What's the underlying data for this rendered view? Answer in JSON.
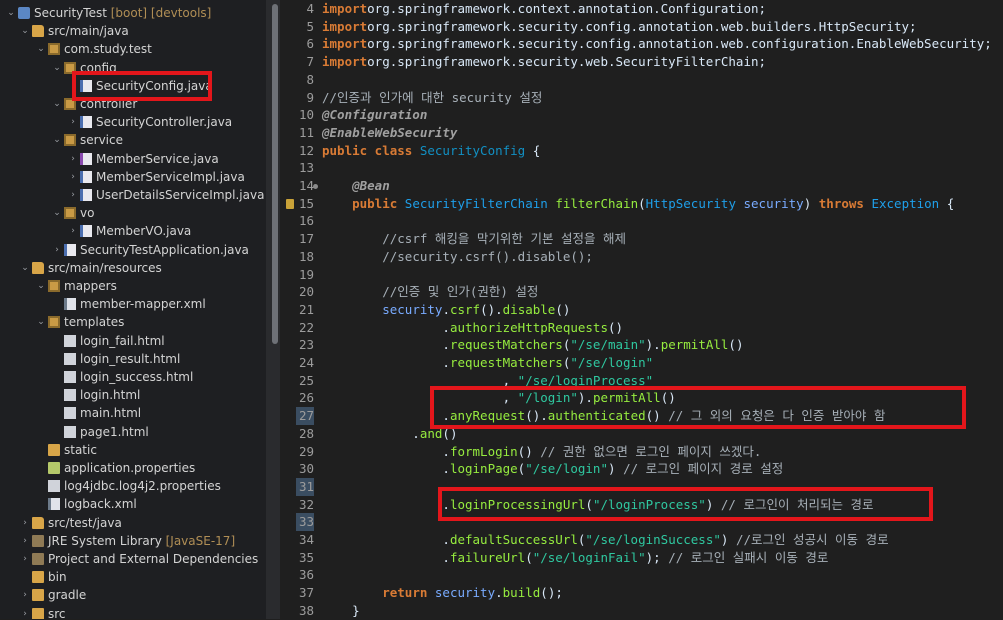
{
  "explorer": {
    "items": [
      {
        "label": "SecurityTest",
        "deco": " [boot] [devtools]",
        "arrow": "down",
        "icon": "project-icon"
      },
      {
        "label": "src/main/java",
        "deco": "",
        "arrow": "down",
        "icon": "source-folder-icon"
      },
      {
        "label": "com.study.test",
        "deco": "",
        "arrow": "down",
        "icon": "package-icon"
      },
      {
        "label": "config",
        "deco": "",
        "arrow": "down",
        "icon": "package-icon"
      },
      {
        "label": "SecurityConfig.java",
        "deco": "",
        "arrow": "right",
        "icon": "java-file-icon"
      },
      {
        "label": "controller",
        "deco": "",
        "arrow": "down",
        "icon": "package-icon"
      },
      {
        "label": "SecurityController.java",
        "deco": "",
        "arrow": "right",
        "icon": "java-file-icon"
      },
      {
        "label": "service",
        "deco": "",
        "arrow": "down",
        "icon": "package-icon"
      },
      {
        "label": "MemberService.java",
        "deco": "",
        "arrow": "right",
        "icon": "java-interface-icon"
      },
      {
        "label": "MemberServiceImpl.java",
        "deco": "",
        "arrow": "right",
        "icon": "java-file-icon"
      },
      {
        "label": "UserDetailsServiceImpl.java",
        "deco": "",
        "arrow": "right",
        "icon": "java-file-icon"
      },
      {
        "label": "vo",
        "deco": "",
        "arrow": "down",
        "icon": "package-icon"
      },
      {
        "label": "MemberVO.java",
        "deco": "",
        "arrow": "right",
        "icon": "java-file-icon"
      },
      {
        "label": "SecurityTestApplication.java",
        "deco": "",
        "arrow": "right",
        "icon": "java-file-icon"
      },
      {
        "label": "src/main/resources",
        "deco": "",
        "arrow": "down",
        "icon": "source-folder-icon"
      },
      {
        "label": "mappers",
        "deco": "",
        "arrow": "down",
        "icon": "package-icon"
      },
      {
        "label": "member-mapper.xml",
        "deco": "",
        "arrow": "",
        "icon": "xml-file-icon"
      },
      {
        "label": "templates",
        "deco": "",
        "arrow": "down",
        "icon": "package-icon"
      },
      {
        "label": "login_fail.html",
        "deco": "",
        "arrow": "",
        "icon": "html-file-icon"
      },
      {
        "label": "login_result.html",
        "deco": "",
        "arrow": "",
        "icon": "html-file-icon"
      },
      {
        "label": "login_success.html",
        "deco": "",
        "arrow": "",
        "icon": "html-file-icon"
      },
      {
        "label": "login.html",
        "deco": "",
        "arrow": "",
        "icon": "html-file-icon"
      },
      {
        "label": "main.html",
        "deco": "",
        "arrow": "",
        "icon": "html-file-icon"
      },
      {
        "label": "page1.html",
        "deco": "",
        "arrow": "",
        "icon": "html-file-icon"
      },
      {
        "label": "static",
        "deco": "",
        "arrow": "",
        "icon": "folder-icon"
      },
      {
        "label": "application.properties",
        "deco": "",
        "arrow": "",
        "icon": "properties-file-icon"
      },
      {
        "label": "log4jdbc.log4j2.properties",
        "deco": "",
        "arrow": "",
        "icon": "file-icon"
      },
      {
        "label": "logback.xml",
        "deco": "",
        "arrow": "",
        "icon": "xml-file-icon"
      },
      {
        "label": "src/test/java",
        "deco": "",
        "arrow": "right",
        "icon": "source-folder-icon"
      },
      {
        "label": "JRE System Library",
        "deco": " [JavaSE-17]",
        "arrow": "right",
        "icon": "library-icon"
      },
      {
        "label": "Project and External Dependencies",
        "deco": "",
        "arrow": "right",
        "icon": "library-icon"
      },
      {
        "label": "bin",
        "deco": "",
        "arrow": "",
        "icon": "folder-icon"
      },
      {
        "label": "gradle",
        "deco": "",
        "arrow": "right",
        "icon": "folder-icon"
      },
      {
        "label": "src",
        "deco": "",
        "arrow": "right",
        "icon": "folder-icon"
      }
    ]
  },
  "editor": {
    "lines": [
      {
        "n": "4",
        "tokens": [
          [
            "k",
            "import"
          ],
          [
            "",
            "org.springframework.context.annotation.Configuration;"
          ]
        ]
      },
      {
        "n": "5",
        "tokens": [
          [
            "k",
            "import"
          ],
          [
            "",
            "org.springframework.security.config.annotation.web.builders.HttpSecurity;"
          ]
        ]
      },
      {
        "n": "6",
        "tokens": [
          [
            "k",
            "import"
          ],
          [
            "",
            "org.springframework.security.config.annotation.web.configuration.EnableWebSecurity;"
          ]
        ]
      },
      {
        "n": "7",
        "tokens": [
          [
            "k",
            "import"
          ],
          [
            "",
            "org.springframework.security.web.SecurityFilterChain;"
          ]
        ]
      },
      {
        "n": "8",
        "tokens": []
      },
      {
        "n": "9",
        "tokens": [
          [
            "cm",
            "//인증과 인가에 대한 security 설정"
          ]
        ]
      },
      {
        "n": "10",
        "tokens": [
          [
            "an",
            "@Configuration"
          ]
        ]
      },
      {
        "n": "11",
        "tokens": [
          [
            "an",
            "@EnableWebSecurity"
          ]
        ]
      },
      {
        "n": "12",
        "tokens": [
          [
            "k",
            "public class"
          ],
          [
            "",
            " "
          ],
          [
            "cls",
            "SecurityConfig"
          ],
          [
            "",
            " {"
          ]
        ]
      },
      {
        "n": "13",
        "tokens": []
      },
      {
        "n": "14",
        "tokens": [
          [
            "",
            "    "
          ],
          [
            "an",
            "@Bean"
          ]
        ]
      },
      {
        "n": "15",
        "tokens": [
          [
            "",
            "    "
          ],
          [
            "k",
            "public"
          ],
          [
            "",
            " "
          ],
          [
            "ty",
            "SecurityFilterChain"
          ],
          [
            "",
            " "
          ],
          [
            "mt",
            "filterChain"
          ],
          [
            "",
            "("
          ],
          [
            "ty",
            "HttpSecurity"
          ],
          [
            "",
            " "
          ],
          [
            "pa",
            "security"
          ],
          [
            "",
            ") "
          ],
          [
            "k",
            "throws"
          ],
          [
            "",
            " "
          ],
          [
            "ty",
            "Exception"
          ],
          [
            "",
            " {"
          ]
        ]
      },
      {
        "n": "16",
        "tokens": []
      },
      {
        "n": "17",
        "tokens": [
          [
            "",
            "        "
          ],
          [
            "cm",
            "//csrf 해킹을 막기위한 기본 설정을 해제"
          ]
        ]
      },
      {
        "n": "18",
        "tokens": [
          [
            "",
            "        "
          ],
          [
            "cm",
            "//security.csrf().disable();"
          ]
        ]
      },
      {
        "n": "19",
        "tokens": []
      },
      {
        "n": "20",
        "tokens": [
          [
            "",
            "        "
          ],
          [
            "cm",
            "//인증 및 인가(권한) 설정"
          ]
        ]
      },
      {
        "n": "21",
        "tokens": [
          [
            "",
            "        "
          ],
          [
            "pa",
            "security"
          ],
          [
            "",
            "."
          ],
          [
            "mt",
            "csrf"
          ],
          [
            "",
            "()."
          ],
          [
            "mt",
            "disable"
          ],
          [
            "",
            "()"
          ]
        ]
      },
      {
        "n": "22",
        "tokens": [
          [
            "",
            "                ."
          ],
          [
            "mt",
            "authorizeHttpRequests"
          ],
          [
            "",
            "()"
          ]
        ]
      },
      {
        "n": "23",
        "tokens": [
          [
            "",
            "                ."
          ],
          [
            "mt",
            "requestMatchers"
          ],
          [
            "",
            "("
          ],
          [
            "st",
            "\"/se/main\""
          ],
          [
            "",
            ")."
          ],
          [
            "mt",
            "permitAll"
          ],
          [
            "",
            "()"
          ]
        ]
      },
      {
        "n": "24",
        "tokens": [
          [
            "",
            "                ."
          ],
          [
            "mt",
            "requestMatchers"
          ],
          [
            "",
            "("
          ],
          [
            "st",
            "\"/se/login\""
          ]
        ]
      },
      {
        "n": "25",
        "tokens": [
          [
            "",
            "                        , "
          ],
          [
            "st",
            "\"/se/loginProcess\""
          ]
        ]
      },
      {
        "n": "26",
        "tokens": [
          [
            "",
            "                        , "
          ],
          [
            "st",
            "\"/login\""
          ],
          [
            "",
            ")."
          ],
          [
            "mt",
            "permitAll"
          ],
          [
            "",
            "()"
          ]
        ]
      },
      {
        "n": "27",
        "tokens": [
          [
            "",
            "                ."
          ],
          [
            "mt",
            "anyRequest"
          ],
          [
            "",
            "()."
          ],
          [
            "mt",
            "authenticated"
          ],
          [
            "",
            "() "
          ],
          [
            "cm",
            "// 그 외의 요청은 다 인증 받아야 함"
          ]
        ]
      },
      {
        "n": "28",
        "tokens": [
          [
            "",
            "            ."
          ],
          [
            "mt",
            "and"
          ],
          [
            "",
            "()"
          ]
        ]
      },
      {
        "n": "29",
        "tokens": [
          [
            "",
            "                ."
          ],
          [
            "mt",
            "formLogin"
          ],
          [
            "",
            "() "
          ],
          [
            "cm",
            "// 권한 없으면 로그인 페이지 쓰겠다."
          ]
        ]
      },
      {
        "n": "30",
        "tokens": [
          [
            "",
            "                ."
          ],
          [
            "mt",
            "loginPage"
          ],
          [
            "",
            "("
          ],
          [
            "st",
            "\"/se/login\""
          ],
          [
            "",
            ") "
          ],
          [
            "cm",
            "// 로그인 페이지 경로 설정"
          ]
        ]
      },
      {
        "n": "31",
        "tokens": []
      },
      {
        "n": "32",
        "tokens": [
          [
            "",
            "                ."
          ],
          [
            "mt",
            "loginProcessingUrl"
          ],
          [
            "",
            "("
          ],
          [
            "st",
            "\"/loginProcess\""
          ],
          [
            "",
            ") "
          ],
          [
            "cm",
            "// 로그인이 처리되는 경로"
          ]
        ]
      },
      {
        "n": "33",
        "tokens": []
      },
      {
        "n": "34",
        "tokens": [
          [
            "",
            "                ."
          ],
          [
            "mt",
            "defaultSuccessUrl"
          ],
          [
            "",
            "("
          ],
          [
            "st",
            "\"/se/loginSuccess\""
          ],
          [
            "",
            ") "
          ],
          [
            "cm",
            "//로그인 성공시 이동 경로"
          ]
        ]
      },
      {
        "n": "35",
        "tokens": [
          [
            "",
            "                ."
          ],
          [
            "mt",
            "failureUrl"
          ],
          [
            "",
            "("
          ],
          [
            "st",
            "\"/se/loginFail\""
          ],
          [
            "",
            "); "
          ],
          [
            "cm",
            "// 로그인 실패시 이동 경로"
          ]
        ]
      },
      {
        "n": "36",
        "tokens": []
      },
      {
        "n": "37",
        "tokens": [
          [
            "",
            "        "
          ],
          [
            "k",
            "return"
          ],
          [
            "",
            " "
          ],
          [
            "pa",
            "security"
          ],
          [
            "",
            "."
          ],
          [
            "mt",
            "build"
          ],
          [
            "",
            "();"
          ]
        ]
      },
      {
        "n": "38",
        "tokens": [
          [
            "",
            "    }"
          ]
        ]
      }
    ]
  }
}
